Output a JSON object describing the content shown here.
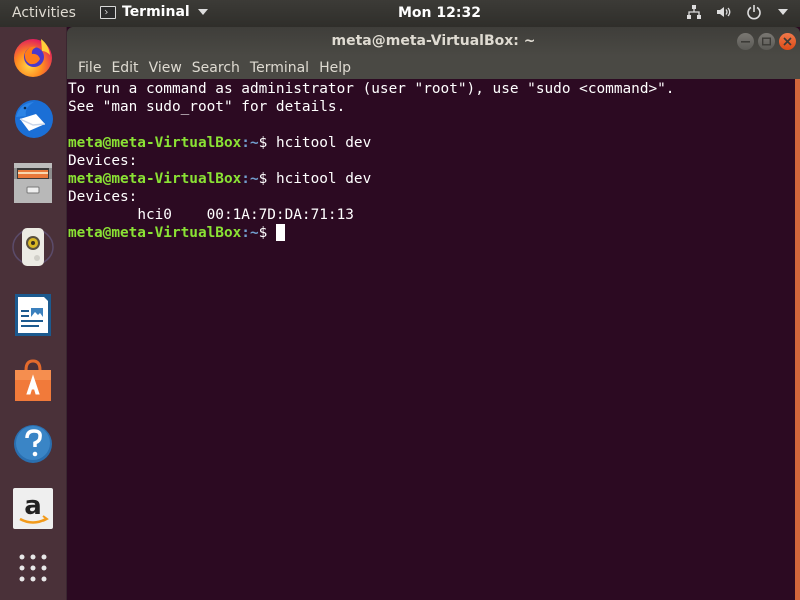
{
  "top_panel": {
    "activities_label": "Activities",
    "app_menu_label": "Terminal",
    "app_menu_icon": "terminal-icon",
    "clock": "Mon 12:32",
    "tray_icons": [
      "network-icon",
      "volume-icon",
      "power-icon",
      "chevron-down-icon"
    ]
  },
  "dock": {
    "items": [
      {
        "name": "Firefox",
        "icon": "firefox-icon"
      },
      {
        "name": "Thunderbird",
        "icon": "thunderbird-icon"
      },
      {
        "name": "Files",
        "icon": "files-icon"
      },
      {
        "name": "Rhythmbox",
        "icon": "rhythmbox-icon"
      },
      {
        "name": "LibreOffice Writer",
        "icon": "writer-icon"
      },
      {
        "name": "Ubuntu Software",
        "icon": "software-icon"
      },
      {
        "name": "Help",
        "icon": "help-icon"
      },
      {
        "name": "Amazon",
        "icon": "amazon-icon"
      },
      {
        "name": "Show Applications",
        "icon": "app-grid-icon"
      }
    ]
  },
  "window": {
    "title": "meta@meta-VirtualBox: ~",
    "controls": [
      "minimize",
      "maximize",
      "close"
    ],
    "menu": [
      "File",
      "Edit",
      "View",
      "Search",
      "Terminal",
      "Help"
    ],
    "accent_color": "#e95420"
  },
  "terminal": {
    "prompt_user": "meta@meta-VirtualBox",
    "prompt_path": ":~",
    "prompt_symbol": "$ ",
    "lines": [
      {
        "type": "text",
        "text": "To run a command as administrator (user \"root\"), use \"sudo <command>\"."
      },
      {
        "type": "text",
        "text": "See \"man sudo_root\" for details."
      },
      {
        "type": "text",
        "text": ""
      },
      {
        "type": "prompt",
        "command": "hcitool dev"
      },
      {
        "type": "text",
        "text": "Devices:"
      },
      {
        "type": "prompt",
        "command": "hcitool dev"
      },
      {
        "type": "text",
        "text": "Devices:"
      },
      {
        "type": "text",
        "text": "\thci0\t00:1A:7D:DA:71:13"
      },
      {
        "type": "prompt",
        "command": "",
        "cursor": true
      }
    ]
  }
}
